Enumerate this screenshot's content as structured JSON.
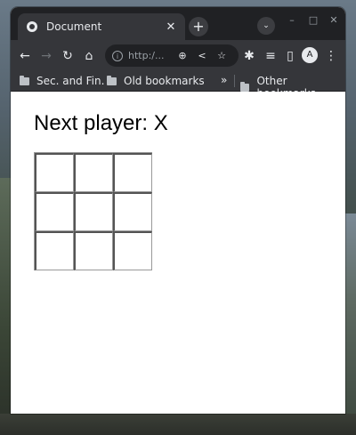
{
  "browser": {
    "tab_title": "Document",
    "tab_close": "✕",
    "new_tab": "+",
    "tab_search": "⌄",
    "min": "–",
    "max": "□",
    "close": "✕",
    "url": "http:/...",
    "nav": {
      "back": "←",
      "forward": "→",
      "reload": "↻",
      "home": "⌂"
    },
    "omnibox_icons": {
      "info": "i",
      "zoom": "⊕",
      "share": "<",
      "star": "☆"
    },
    "toolbar_icons": {
      "extensions": "✱",
      "playlist": "≡",
      "sidepanel": "▯",
      "profile": "A",
      "menu": "⋮"
    }
  },
  "bookmarks": {
    "items": [
      "Sec. and Fin.",
      "Old bookmarks"
    ],
    "more": "»",
    "other": "Other bookmarks"
  },
  "game": {
    "status": "Next player: X",
    "squares": [
      "",
      "",
      "",
      "",
      "",
      "",
      "",
      "",
      ""
    ]
  }
}
